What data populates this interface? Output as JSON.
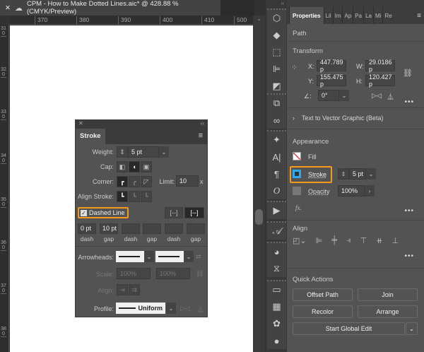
{
  "document": {
    "tab_title": "CPM - How to Make Dotted Lines.aic* @ 428.88 % (CMYK/Preview)"
  },
  "rulers": {
    "horizontal": [
      "370",
      "380",
      "390",
      "400",
      "410",
      "500"
    ],
    "vertical": [
      "310",
      "320",
      "330",
      "340",
      "350",
      "360",
      "370",
      "380"
    ]
  },
  "stroke_panel": {
    "title": "Stroke",
    "weight_label": "Weight:",
    "weight": "5 pt",
    "cap_label": "Cap:",
    "corner_label": "Corner:",
    "limit_label": "Limit:",
    "limit": "10",
    "limit_unit": "x",
    "align_label": "Align Stroke:",
    "dashed_label": "Dashed Line",
    "dashed_checked": true,
    "dashes": [
      {
        "value": "0 pt",
        "label": "dash"
      },
      {
        "value": "10 pt",
        "label": "gap"
      },
      {
        "value": "",
        "label": "dash"
      },
      {
        "value": "",
        "label": "gap"
      },
      {
        "value": "",
        "label": "dash"
      },
      {
        "value": "",
        "label": "gap"
      }
    ],
    "arrowheads_label": "Arrowheads:",
    "scale_label": "Scale:",
    "scale_start": "100%",
    "scale_end": "100%",
    "align_arrow_label": "Align:",
    "profile_label": "Profile:",
    "profile": "Uniform"
  },
  "properties": {
    "tabs": [
      "Properties",
      "Lil",
      "Im",
      "Ap",
      "Pa",
      "La",
      "Mi",
      "Re"
    ],
    "selection": "Path",
    "transform": {
      "title": "Transform",
      "x_label": "X:",
      "x": "447.789 p",
      "y_label": "Y:",
      "y": "155.475 p",
      "w_label": "W:",
      "w": "29.0186 p",
      "h_label": "H:",
      "h": "120.427 p",
      "angle": "0°"
    },
    "text_to_vector": "Text to Vector Graphic (Beta)",
    "appearance": {
      "title": "Appearance",
      "fill": "Fill",
      "stroke": "Stroke",
      "stroke_weight": "5 pt",
      "opacity_label": "Opacity",
      "opacity": "100%",
      "fx": "fx."
    },
    "align": {
      "title": "Align"
    },
    "quick_actions": {
      "title": "Quick Actions",
      "offset_path": "Offset Path",
      "join": "Join",
      "recolor": "Recolor",
      "arrange": "Arrange",
      "global_edit": "Start Global Edit"
    }
  },
  "colors": {
    "highlight": "#f39a1e",
    "panel": "#535353"
  }
}
